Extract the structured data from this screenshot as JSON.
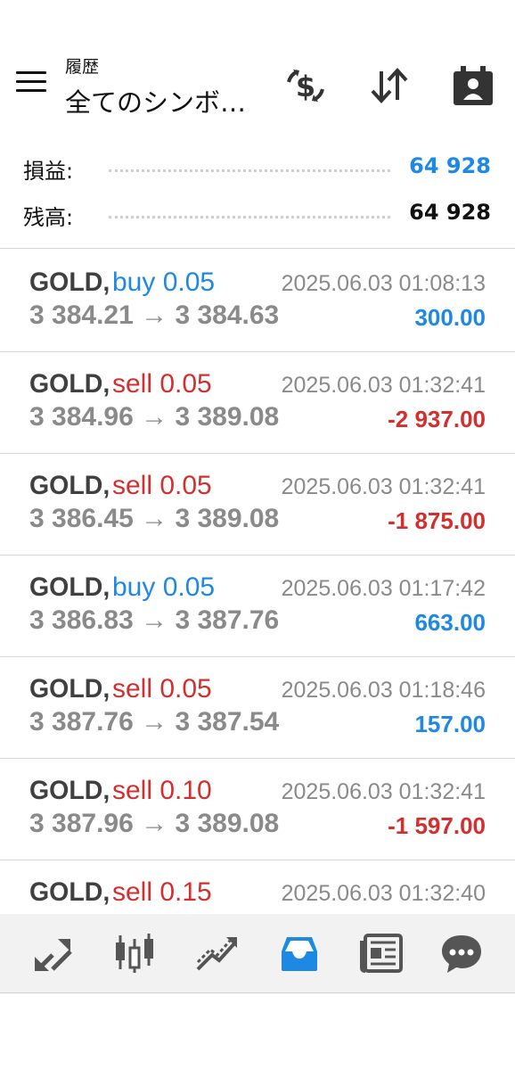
{
  "header": {
    "subtitle": "履歴",
    "title": "全てのシンボ…"
  },
  "summary": {
    "profit_label": "損益:",
    "profit_value": "64 928",
    "balance_label": "残高:",
    "balance_value": "64 928"
  },
  "colors": {
    "buy": "#1e88e5",
    "sell": "#d32f2f",
    "positive": "#1e88e5",
    "negative": "#d32f2f",
    "active_tab": "#1e88e5"
  },
  "trades": [
    {
      "symbol": "GOLD,",
      "side": "buy 0.05",
      "time": "2025.06.03 01:08:13",
      "prices": "3 384.21 → 3 384.63",
      "profit": "300.00",
      "dir": "buy",
      "sign": "pos"
    },
    {
      "symbol": "GOLD,",
      "side": "sell 0.05",
      "time": "2025.06.03 01:32:41",
      "prices": "3 384.96 → 3 389.08",
      "profit": "-2 937.00",
      "dir": "sell",
      "sign": "neg"
    },
    {
      "symbol": "GOLD,",
      "side": "sell 0.05",
      "time": "2025.06.03 01:32:41",
      "prices": "3 386.45 → 3 389.08",
      "profit": "-1 875.00",
      "dir": "sell",
      "sign": "neg"
    },
    {
      "symbol": "GOLD,",
      "side": "buy 0.05",
      "time": "2025.06.03 01:17:42",
      "prices": "3 386.83 → 3 387.76",
      "profit": "663.00",
      "dir": "buy",
      "sign": "pos"
    },
    {
      "symbol": "GOLD,",
      "side": "sell 0.05",
      "time": "2025.06.03 01:18:46",
      "prices": "3 387.76 → 3 387.54",
      "profit": "157.00",
      "dir": "sell",
      "sign": "pos"
    },
    {
      "symbol": "GOLD,",
      "side": "sell 0.10",
      "time": "2025.06.03 01:32:41",
      "prices": "3 387.96 → 3 389.08",
      "profit": "-1 597.00",
      "dir": "sell",
      "sign": "neg"
    },
    {
      "symbol": "GOLD,",
      "side": "sell 0.15",
      "time": "2025.06.03 01:32:40",
      "prices": "",
      "profit": "",
      "dir": "sell",
      "sign": "neg"
    }
  ],
  "nav": [
    {
      "icon": "quotes-icon",
      "active": false
    },
    {
      "icon": "chart-icon",
      "active": false
    },
    {
      "icon": "trade-icon",
      "active": false
    },
    {
      "icon": "history-icon",
      "active": true
    },
    {
      "icon": "news-icon",
      "active": false
    },
    {
      "icon": "chat-icon",
      "active": false
    }
  ],
  "header_icons": [
    "currency-exchange-icon",
    "sort-icon",
    "calendar-person-icon"
  ]
}
